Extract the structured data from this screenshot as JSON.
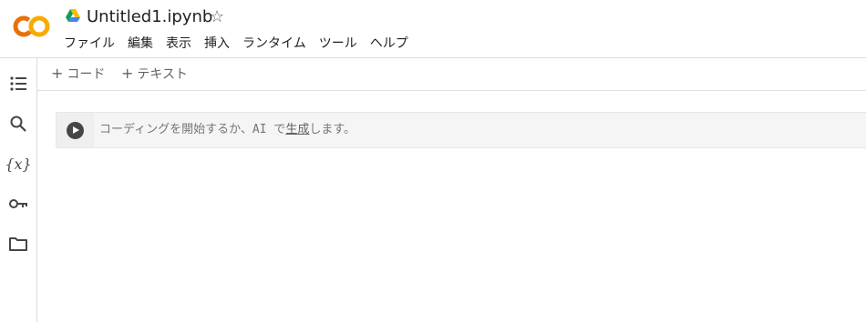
{
  "header": {
    "title": "Untitled1.ipynb",
    "menu": [
      "ファイル",
      "編集",
      "表示",
      "挿入",
      "ランタイム",
      "ツール",
      "ヘルプ"
    ]
  },
  "toolbar": {
    "add_code": "コード",
    "add_text": "テキスト"
  },
  "sidebar": {
    "icons": [
      "toc-icon",
      "search-icon",
      "variables-icon",
      "key-icon",
      "folder-icon"
    ],
    "variables_glyph": "{x}"
  },
  "cell": {
    "placeholder_before": "コーディングを開始するか、AI で",
    "placeholder_link": "生成",
    "placeholder_after": "します。"
  },
  "colors": {
    "logo_orange": "#F9AB00",
    "logo_dark_orange": "#E8710A",
    "run_button": "#444746",
    "border": "#dadce0"
  }
}
